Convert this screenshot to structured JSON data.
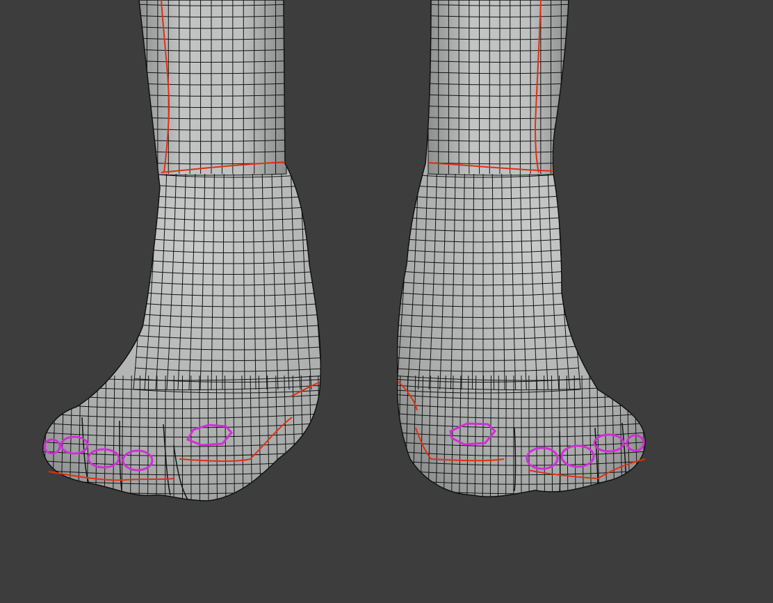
{
  "viewport": {
    "background_color": "#3d3d3d",
    "mesh_fill_color": "#b9bbbb",
    "wire_color": "#111111",
    "seam_color": "#e03010",
    "selection_color": "#d02ed6"
  },
  "objects": [
    {
      "name": "left-foot",
      "selected_faces_outlined": 5,
      "seams": true
    },
    {
      "name": "right-foot",
      "selected_faces_outlined": 5,
      "seams": true
    }
  ]
}
